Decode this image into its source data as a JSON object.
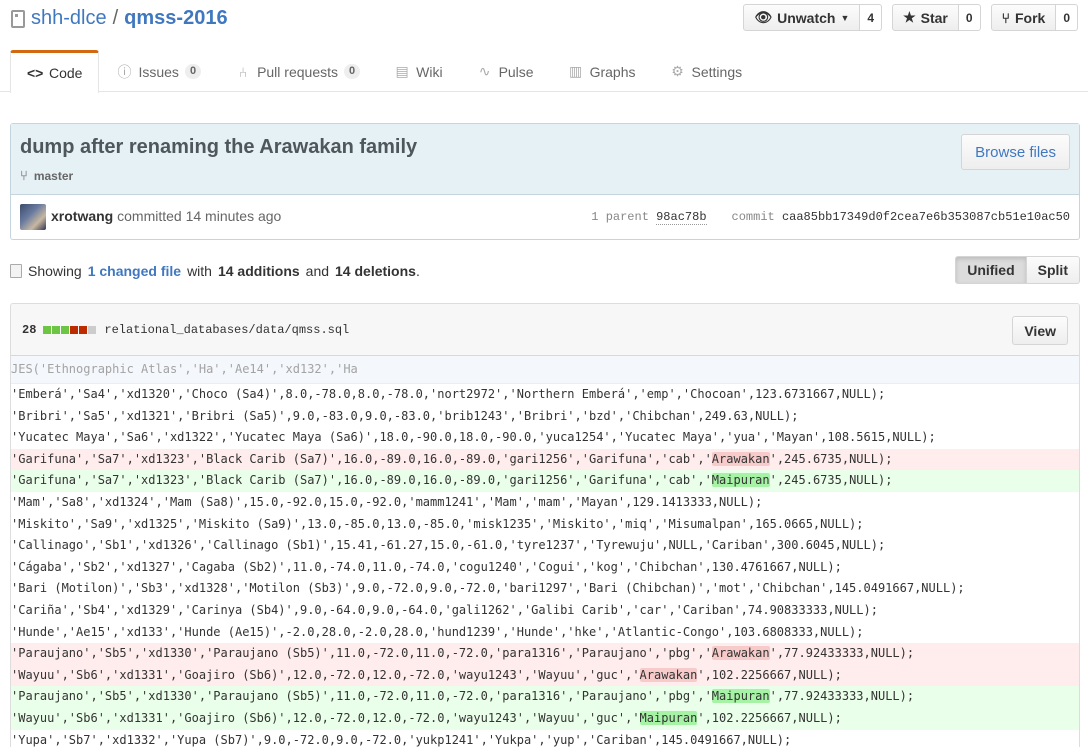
{
  "repo": {
    "owner": "shh-dlce",
    "separator": "/",
    "name": "qmss-2016",
    "icon": "repo-icon"
  },
  "actions": {
    "watch": {
      "label": "Unwatch",
      "count": "4",
      "icon": "eye-icon"
    },
    "star": {
      "label": "Star",
      "count": "0",
      "icon": "star-icon"
    },
    "fork": {
      "label": "Fork",
      "count": "0",
      "icon": "fork-icon"
    }
  },
  "nav": {
    "code": {
      "label": "Code",
      "icon": "code-icon"
    },
    "issues": {
      "label": "Issues",
      "count": "0",
      "icon": "issue-icon"
    },
    "pulls": {
      "label": "Pull requests",
      "count": "0",
      "icon": "pull-request-icon"
    },
    "wiki": {
      "label": "Wiki",
      "icon": "book-icon"
    },
    "pulse": {
      "label": "Pulse",
      "icon": "pulse-icon"
    },
    "graphs": {
      "label": "Graphs",
      "icon": "graph-icon"
    },
    "settings": {
      "label": "Settings",
      "icon": "gear-icon"
    }
  },
  "commit": {
    "title": "dump after renaming the Arawakan family",
    "branch": "master",
    "browse_label": "Browse files",
    "author": "xrotwang",
    "committed_text": "committed 14 minutes ago",
    "parent_label": "1 parent",
    "parent_sha": "98ac78b",
    "commit_label": "commit",
    "commit_sha": "caa85bb17349d0f2cea7e6b353087cb51e10ac50"
  },
  "toc": {
    "showing": "Showing",
    "changed_link": "1 changed file",
    "with": "with",
    "additions": "14 additions",
    "and": "and",
    "deletions": "14 deletions",
    "period": ".",
    "unified_label": "Unified",
    "split_label": "Split"
  },
  "file": {
    "changes": "28",
    "path": "relational_databases/data/qmss.sql",
    "view_label": "View",
    "diffstat_colors": [
      "#6cc644",
      "#6cc644",
      "#6cc644",
      "#bd2c00",
      "#bd2c00",
      "#cccccc"
    ]
  },
  "diff": {
    "hunk": "JES('Ethnographic Atlas','Ha','Ae14','xd132','Ha",
    "lines": [
      {
        "type": "ctx",
        "pre": "'Emberá','Sa4','xd1320','Choco (Sa4)',8.0,-78.0,8.0,-78.0,'nort2972','Northern Emberá','emp','Chocoan',123.6731667,NULL);",
        "hl": "",
        "post": ""
      },
      {
        "type": "ctx",
        "pre": "'Bribri','Sa5','xd1321','Bribri (Sa5)',9.0,-83.0,9.0,-83.0,'brib1243','Bribri','bzd','Chibchan',249.63,NULL);",
        "hl": "",
        "post": ""
      },
      {
        "type": "ctx",
        "pre": "'Yucatec Maya','Sa6','xd1322','Yucatec Maya (Sa6)',18.0,-90.0,18.0,-90.0,'yuca1254','Yucatec Maya','yua','Mayan',108.5615,NULL);",
        "hl": "",
        "post": ""
      },
      {
        "type": "del",
        "pre": "'Garifuna','Sa7','xd1323','Black Carib (Sa7)',16.0,-89.0,16.0,-89.0,'gari1256','Garifuna','cab','",
        "hl": "Arawakan",
        "post": "',245.6735,NULL);"
      },
      {
        "type": "add",
        "pre": "'Garifuna','Sa7','xd1323','Black Carib (Sa7)',16.0,-89.0,16.0,-89.0,'gari1256','Garifuna','cab','",
        "hl": "Maipuran",
        "post": "',245.6735,NULL);"
      },
      {
        "type": "ctx",
        "pre": "'Mam','Sa8','xd1324','Mam (Sa8)',15.0,-92.0,15.0,-92.0,'mamm1241','Mam','mam','Mayan',129.1413333,NULL);",
        "hl": "",
        "post": ""
      },
      {
        "type": "ctx",
        "pre": "'Miskito','Sa9','xd1325','Miskito (Sa9)',13.0,-85.0,13.0,-85.0,'misk1235','Miskito','miq','Misumalpan',165.0665,NULL);",
        "hl": "",
        "post": ""
      },
      {
        "type": "ctx",
        "pre": "'Callinago','Sb1','xd1326','Callinago (Sb1)',15.41,-61.27,15.0,-61.0,'tyre1237','Tyrewuju',NULL,'Cariban',300.6045,NULL);",
        "hl": "",
        "post": ""
      },
      {
        "type": "ctx",
        "pre": "'Cágaba','Sb2','xd1327','Cagaba (Sb2)',11.0,-74.0,11.0,-74.0,'cogu1240','Cogui','kog','Chibchan',130.4761667,NULL);",
        "hl": "",
        "post": ""
      },
      {
        "type": "ctx",
        "pre": "'Bari (Motilon)','Sb3','xd1328','Motilon (Sb3)',9.0,-72.0,9.0,-72.0,'bari1297','Bari (Chibchan)','mot','Chibchan',145.0491667,NULL);",
        "hl": "",
        "post": ""
      },
      {
        "type": "ctx",
        "pre": "'Cariña','Sb4','xd1329','Carinya (Sb4)',9.0,-64.0,9.0,-64.0,'gali1262','Galibi Carib','car','Cariban',74.90833333,NULL);",
        "hl": "",
        "post": ""
      },
      {
        "type": "ctx",
        "pre": "'Hunde','Ae15','xd133','Hunde (Ae15)',-2.0,28.0,-2.0,28.0,'hund1239','Hunde','hke','Atlantic-Congo',103.6808333,NULL);",
        "hl": "",
        "post": ""
      },
      {
        "type": "del",
        "pre": "'Paraujano','Sb5','xd1330','Paraujano (Sb5)',11.0,-72.0,11.0,-72.0,'para1316','Paraujano','pbg','",
        "hl": "Arawakan",
        "post": "',77.92433333,NULL);"
      },
      {
        "type": "del",
        "pre": "'Wayuu','Sb6','xd1331','Goajiro (Sb6)',12.0,-72.0,12.0,-72.0,'wayu1243','Wayuu','guc','",
        "hl": "Arawakan",
        "post": "',102.2256667,NULL);"
      },
      {
        "type": "add",
        "pre": "'Paraujano','Sb5','xd1330','Paraujano (Sb5)',11.0,-72.0,11.0,-72.0,'para1316','Paraujano','pbg','",
        "hl": "Maipuran",
        "post": "',77.92433333,NULL);"
      },
      {
        "type": "add",
        "pre": "'Wayuu','Sb6','xd1331','Goajiro (Sb6)',12.0,-72.0,12.0,-72.0,'wayu1243','Wayuu','guc','",
        "hl": "Maipuran",
        "post": "',102.2256667,NULL);"
      },
      {
        "type": "ctx",
        "pre": "'Yupa','Sb7','xd1332','Yupa (Sb7)',9.0,-72.0,9.0,-72.0,'yukp1241','Yukpa','yup','Cariban',145.0491667,NULL);",
        "hl": "",
        "post": ""
      }
    ]
  }
}
